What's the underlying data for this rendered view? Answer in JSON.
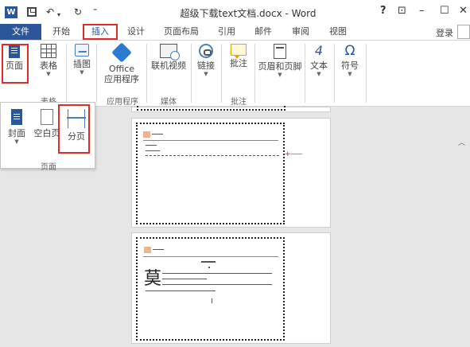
{
  "window": {
    "title": "超级下载text文档.docx - Word",
    "help": "?",
    "ribbon_display": "⊡",
    "minimize": "–",
    "maximize": "☐",
    "close": "✕",
    "undo": "↶",
    "redo": "↻",
    "qa_more": "⁼"
  },
  "tabs": {
    "file": "文件",
    "home": "开始",
    "insert": "插入",
    "design": "设计",
    "layout": "页面布局",
    "references": "引用",
    "mailings": "邮件",
    "review": "审阅",
    "view": "视图",
    "login": "登录"
  },
  "ribbon": {
    "pages": "页面",
    "table": "表格",
    "illustrations": "插图",
    "office_line1": "Office",
    "office_line2": "应用程序",
    "online_video": "联机视频",
    "link": "链接",
    "comment": "批注",
    "header_footer": "页眉和页脚",
    "text": "文本",
    "symbol": "符号",
    "symbol_glyph": "Ω",
    "text_glyph": "4",
    "groups": {
      "table": "表格",
      "apps": "应用程序",
      "media": "媒体",
      "comments": "批注"
    }
  },
  "pages_dropdown": {
    "cover": "封面",
    "blank": "空白页",
    "page_break": "分页",
    "group_label": "页面"
  },
  "document": {
    "page3_char": "莫"
  },
  "colors": {
    "accent": "#2b579a",
    "highlight": "#e12b2b"
  }
}
